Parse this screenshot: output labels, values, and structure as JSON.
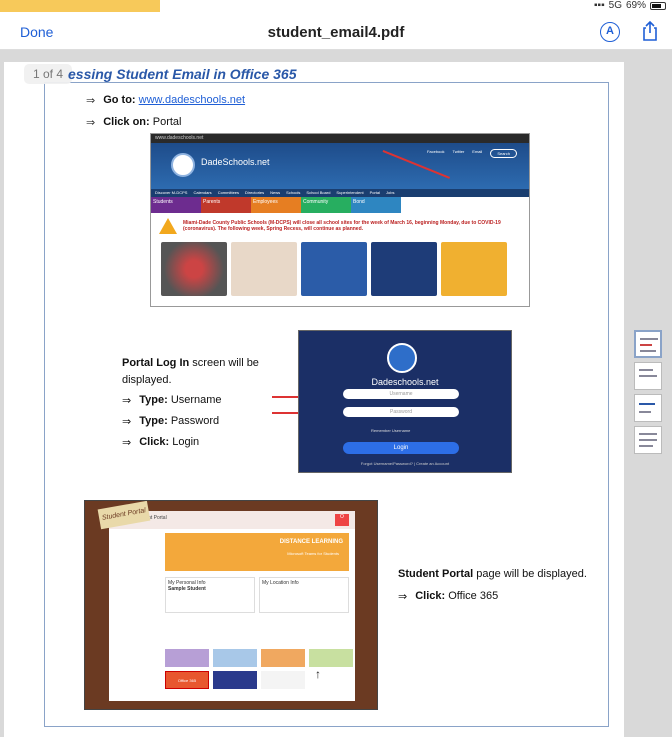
{
  "status": {
    "signal": "5G",
    "battery": "69%"
  },
  "nav": {
    "done_label": "Done",
    "title": "student_email4.pdf"
  },
  "page": {
    "counter": "1 of 4",
    "heading": "essing Student Email in Office 365",
    "goto_label": "Go to:",
    "goto_link": "www.dadeschools.net",
    "click_on_label": "Click on:",
    "click_on_value": "Portal",
    "portal_login_bold": "Portal Log In",
    "portal_login_rest": " screen will be displayed.",
    "type_label": "Type:",
    "username": "Username",
    "password": "Password",
    "click_label": "Click:",
    "login": "Login",
    "student_portal_bold": "Student Portal",
    "student_portal_rest": "  page will be displayed.",
    "office365": "Office 365"
  },
  "shot1": {
    "topbar": "www.dadeschools.net",
    "site_name": "DadeSchools.net",
    "links": [
      "Facebook",
      "Twitter",
      "Email"
    ],
    "search": "Search",
    "menu": [
      "Discover M-DCPS",
      "Calendars",
      "Committees",
      "Directories",
      "News",
      "Schools",
      "School Board",
      "Superintendent",
      "Portal",
      "Jobs"
    ],
    "tiles": [
      "Students",
      "Parents",
      "Employees",
      "Community",
      "Bond"
    ],
    "alert": "Miami-Dade County Public Schools (M-DCPS) will close all school sites for the week of March 16, beginning Monday, due to COVID-19 (coronavirus). The following week, Spring Recess, will continue as planned."
  },
  "shot2": {
    "title": "Dadeschools.net",
    "username_placeholder": "Username",
    "password_placeholder": "Password",
    "remember": "Remember Username",
    "login_button": "Login",
    "forgot": "Forgot Username/Password? | Create an Account"
  },
  "shot3": {
    "badge": "Student Portal",
    "header": "Student Portal",
    "banner_title": "DISTANCE LEARNING",
    "banner_sub": "Microsoft Teams for Students",
    "info1_title": "My Personal Info",
    "info1_name": "Sample Student",
    "info2_title": "My Location Info",
    "apps": [
      "",
      "",
      "",
      "",
      "Office 365",
      "",
      ""
    ]
  },
  "colors": {
    "accent": "#1f5fd6",
    "heading": "#2a58a8",
    "portal_blue": "#1b2f66"
  }
}
